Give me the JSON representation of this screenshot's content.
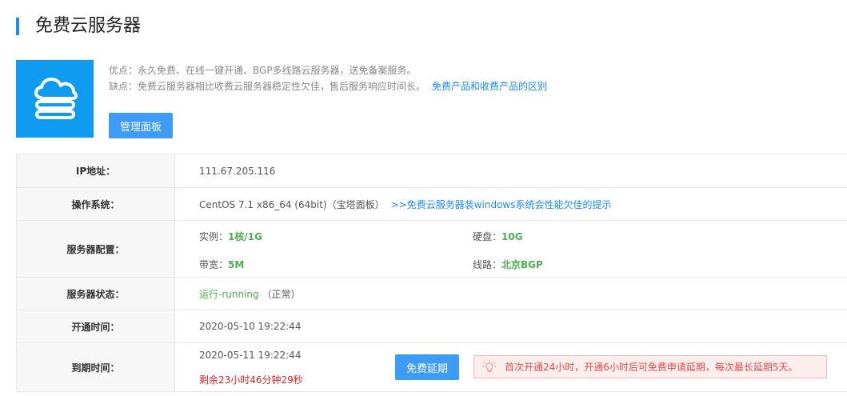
{
  "page": {
    "title": "免费云服务器"
  },
  "product": {
    "icon": "cloud-server-icon",
    "pros": "优点：永久免费、在线一键开通、BGP多线路云服务器，送免备案服务。",
    "cons": "缺点：免费云服务器相比收费云服务器稳定性欠佳，售后服务响应时间长。",
    "compare_link": "免费产品和收费产品的区别",
    "manage_button": "管理面板"
  },
  "info": {
    "ip": {
      "label": "IP地址：",
      "value": "111.67.205.116"
    },
    "os": {
      "label": "操作系统：",
      "value": "CentOS 7.1 x86_64 (64bit)（宝塔面板）",
      "tip_link": ">>免费云服务器装windows系统会性能欠佳的提示"
    },
    "config": {
      "label": "服务器配置：",
      "instance_label": "实例：",
      "instance_value": "1核/1G",
      "disk_label": "硬盘：",
      "disk_value": "10G",
      "bandwidth_label": "带宽：",
      "bandwidth_value": "5M",
      "line_label": "线路：",
      "line_value": "北京BGP"
    },
    "status": {
      "label": "服务器状态：",
      "value": "运行-running",
      "note": "（正常）"
    },
    "open_time": {
      "label": "开通时间：",
      "value": "2020-05-10 19:22:44"
    },
    "expire_time": {
      "label": "到期时间：",
      "value": "2020-05-11 19:22:44",
      "remaining": "剩余23小时46分钟29秒",
      "renew_button": "免费延期",
      "notice": "首次开通24小时，开通6小时后可免费申请延期，每次最长延期5天。"
    }
  },
  "colors": {
    "accent": "#1a8cff",
    "cloud_bg": "#0e9bf0",
    "button": "#3d9cf6",
    "green": "#4caf50",
    "red": "#e02020",
    "notice_bg": "#fdeeee",
    "notice_border": "#f2b8b8"
  }
}
